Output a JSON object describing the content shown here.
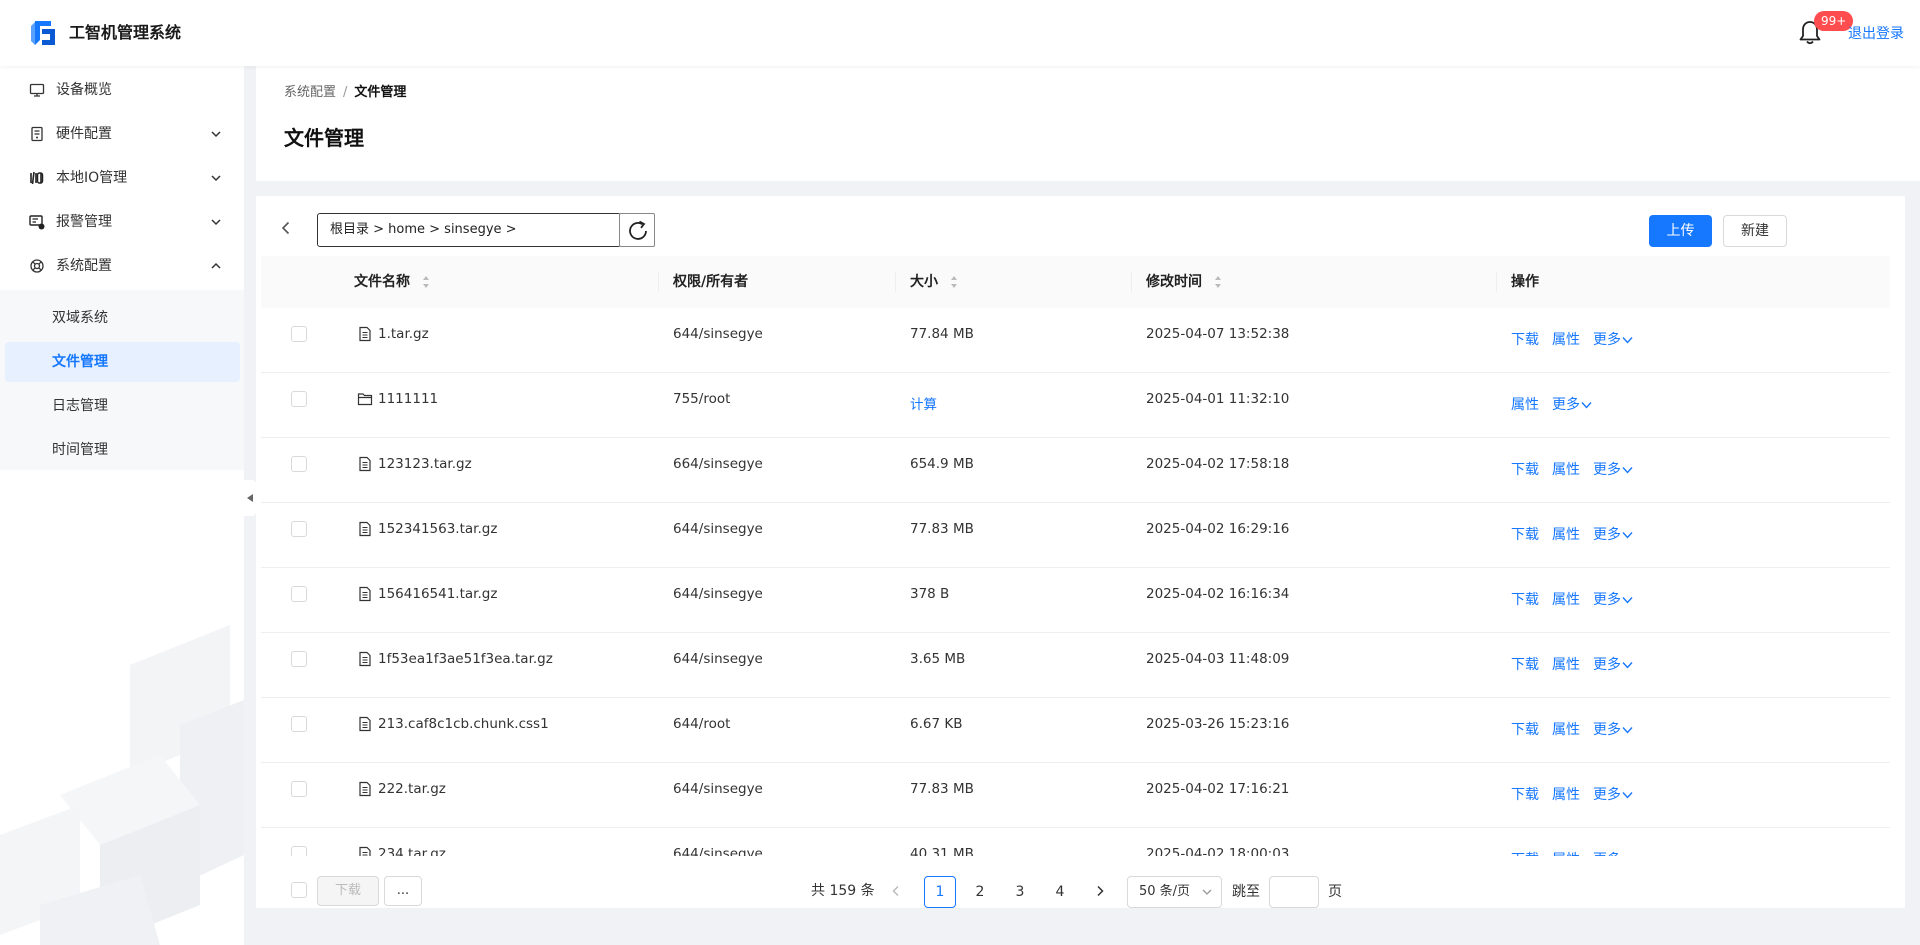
{
  "app": {
    "title": "工智机管理系统",
    "notification_count": "99+",
    "logout_label": "退出登录"
  },
  "sidebar": {
    "items": [
      {
        "label": "设备概览",
        "icon": "monitor-icon"
      },
      {
        "label": "硬件配置",
        "icon": "server-icon"
      },
      {
        "label": "本地IO管理",
        "icon": "io-icon"
      },
      {
        "label": "报警管理",
        "icon": "alarm-icon"
      },
      {
        "label": "系统配置",
        "icon": "settings-icon"
      }
    ],
    "submenu": [
      {
        "label": "双域系统"
      },
      {
        "label": "文件管理"
      },
      {
        "label": "日志管理"
      },
      {
        "label": "时间管理"
      }
    ]
  },
  "breadcrumb": {
    "parent": "系统配置",
    "separator": "/",
    "current": "文件管理"
  },
  "page": {
    "title": "文件管理"
  },
  "toolbar": {
    "path": "根目录 > home > sinsegye >",
    "upload_label": "上传",
    "new_label": "新建"
  },
  "table": {
    "columns": [
      "文件名称",
      "权限/所有者",
      "大小",
      "修改时间",
      "操作"
    ],
    "action_labels": {
      "download": "下载",
      "properties": "属性",
      "more": "更多"
    },
    "rows": [
      {
        "name": "1.tar.gz",
        "type": "file",
        "perm": "644/sinsegye",
        "size": "77.84 MB",
        "time": "2025-04-07 13:52:38"
      },
      {
        "name": "1111111",
        "type": "folder",
        "perm": "755/root",
        "size": "计算",
        "time": "2025-04-01 11:32:10"
      },
      {
        "name": "123123.tar.gz",
        "type": "file",
        "perm": "664/sinsegye",
        "size": "654.9 MB",
        "time": "2025-04-02 17:58:18"
      },
      {
        "name": "152341563.tar.gz",
        "type": "file",
        "perm": "644/sinsegye",
        "size": "77.83 MB",
        "time": "2025-04-02 16:29:16"
      },
      {
        "name": "156416541.tar.gz",
        "type": "file",
        "perm": "644/sinsegye",
        "size": "378 B",
        "time": "2025-04-02 16:16:34"
      },
      {
        "name": "1f53ea1f3ae51f3ea.tar.gz",
        "type": "file",
        "perm": "644/sinsegye",
        "size": "3.65 MB",
        "time": "2025-04-03 11:48:09"
      },
      {
        "name": "213.caf8c1cb.chunk.css1",
        "type": "file",
        "perm": "644/root",
        "size": "6.67 KB",
        "time": "2025-03-26 15:23:16"
      },
      {
        "name": "222.tar.gz",
        "type": "file",
        "perm": "644/sinsegye",
        "size": "77.83 MB",
        "time": "2025-04-02 17:16:21"
      },
      {
        "name": "234.tar.gz",
        "type": "file",
        "perm": "644/sinsegye",
        "size": "40.31 MB",
        "time": "2025-04-02 18:00:03"
      }
    ]
  },
  "footer": {
    "download_label": "下载",
    "more_label": "...",
    "total_text": "共 159 条",
    "pages": [
      "1",
      "2",
      "3",
      "4"
    ],
    "current_page": "1",
    "page_size": "50 条/页",
    "jump_label": "跳至",
    "jump_suffix": "页"
  },
  "colors": {
    "accent": "#1677ff",
    "badge": "#ff4d4f",
    "active_bg": "#e6f0ff"
  }
}
